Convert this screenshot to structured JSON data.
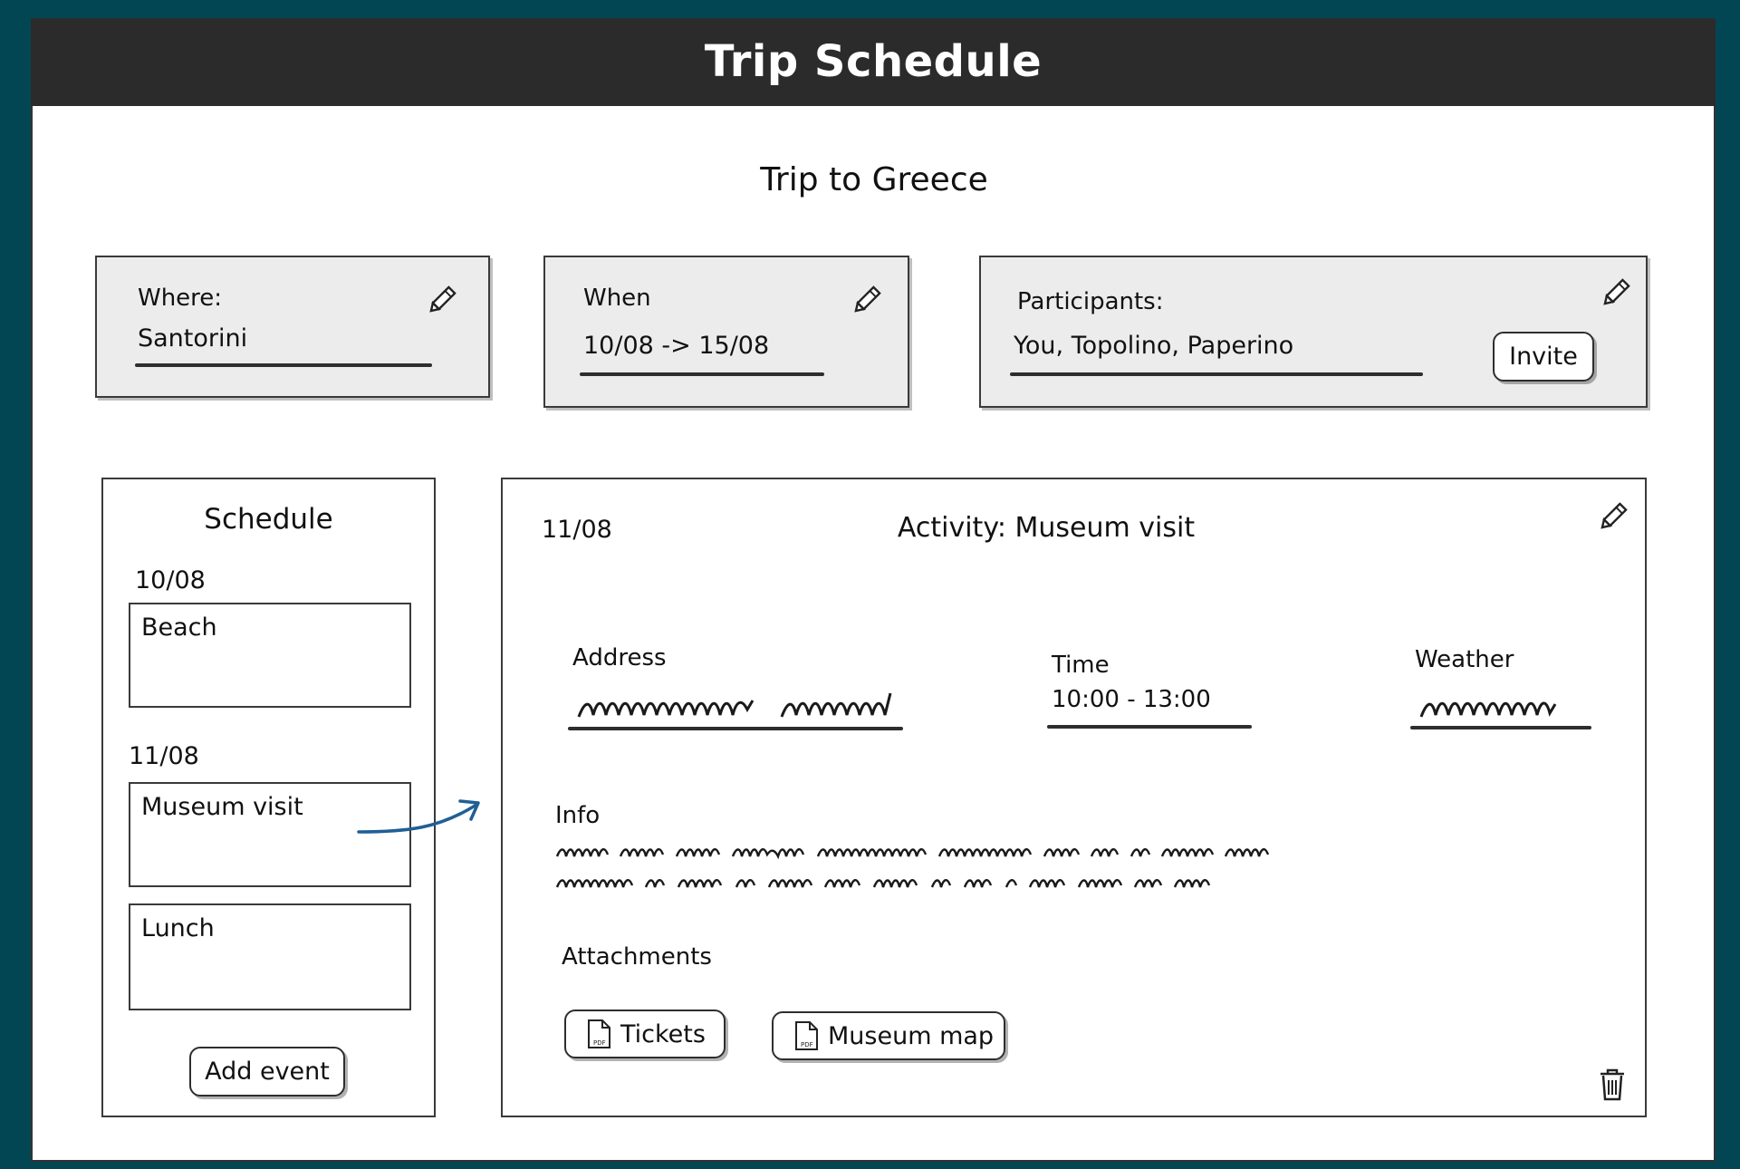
{
  "window": {
    "title": "Trip Schedule"
  },
  "trip": {
    "name": "Trip to Greece"
  },
  "where": {
    "label": "Where:",
    "value": "Santorini"
  },
  "when": {
    "label": "When",
    "value": "10/08 -> 15/08"
  },
  "participants": {
    "label": "Participants:",
    "value": "You, Topolino, Paperino",
    "invite_label": "Invite"
  },
  "schedule": {
    "title": "Schedule",
    "days": [
      {
        "date": "10/08",
        "events": [
          "Beach"
        ]
      },
      {
        "date": "11/08",
        "events": [
          "Museum visit",
          "Lunch"
        ]
      }
    ],
    "add_label": "Add event"
  },
  "activity": {
    "date": "11/08",
    "title": "Activity: Museum visit",
    "address_label": "Address",
    "time_label": "Time",
    "time_value": "10:00 - 13:00",
    "weather_label": "Weather",
    "info_label": "Info",
    "attachments_label": "Attachments",
    "attachments": [
      "Tickets",
      "Museum map"
    ]
  },
  "icons": {
    "edit": "pencil-icon",
    "file": "pdf-file-icon",
    "delete": "trash-icon",
    "arrow": "arrow-icon"
  },
  "colors": {
    "background": "#024654",
    "titlebar": "#2b2b2b",
    "card": "#ececec",
    "arrow": "#1f5f95"
  }
}
